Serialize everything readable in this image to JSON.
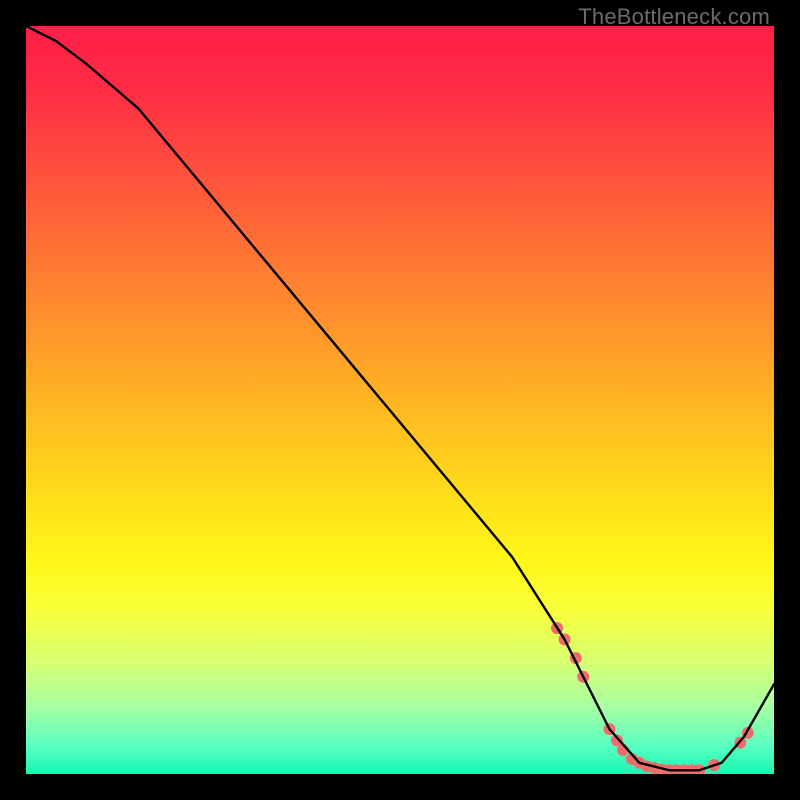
{
  "watermark": "TheBottleneck.com",
  "chart_data": {
    "type": "line",
    "title": "",
    "xlabel": "",
    "ylabel": "",
    "xlim": [
      0,
      100
    ],
    "ylim": [
      0,
      100
    ],
    "background_gradient": {
      "top_color": "#ff1f47",
      "mid_color": "#fff81a",
      "bottom_color": "#17f7b3"
    },
    "series": [
      {
        "name": "curve",
        "color": "#000000",
        "x": [
          0,
          4,
          8,
          15,
          25,
          35,
          45,
          55,
          65,
          72,
          75,
          78,
          82,
          86,
          90,
          93,
          96,
          100
        ],
        "values": [
          100,
          98,
          95,
          89,
          77,
          65,
          53,
          41,
          29,
          18,
          12,
          6,
          1.5,
          0.5,
          0.5,
          1.5,
          5,
          12
        ]
      }
    ],
    "markers": {
      "name": "highlight-dots",
      "color": "#ef6c6c",
      "radius": 6,
      "points_xy": [
        [
          71,
          19.5
        ],
        [
          72,
          18
        ],
        [
          73.5,
          15.5
        ],
        [
          74.5,
          13
        ],
        [
          78,
          6
        ],
        [
          79,
          4.5
        ],
        [
          79.8,
          3.2
        ],
        [
          81,
          2
        ],
        [
          82,
          1.5
        ],
        [
          83,
          1
        ],
        [
          84,
          0.8
        ],
        [
          85,
          0.6
        ],
        [
          86,
          0.5
        ],
        [
          87,
          0.5
        ],
        [
          88,
          0.5
        ],
        [
          89,
          0.5
        ],
        [
          90,
          0.5
        ],
        [
          92,
          1.2
        ],
        [
          95.5,
          4.2
        ],
        [
          96.5,
          5.5
        ]
      ]
    }
  }
}
